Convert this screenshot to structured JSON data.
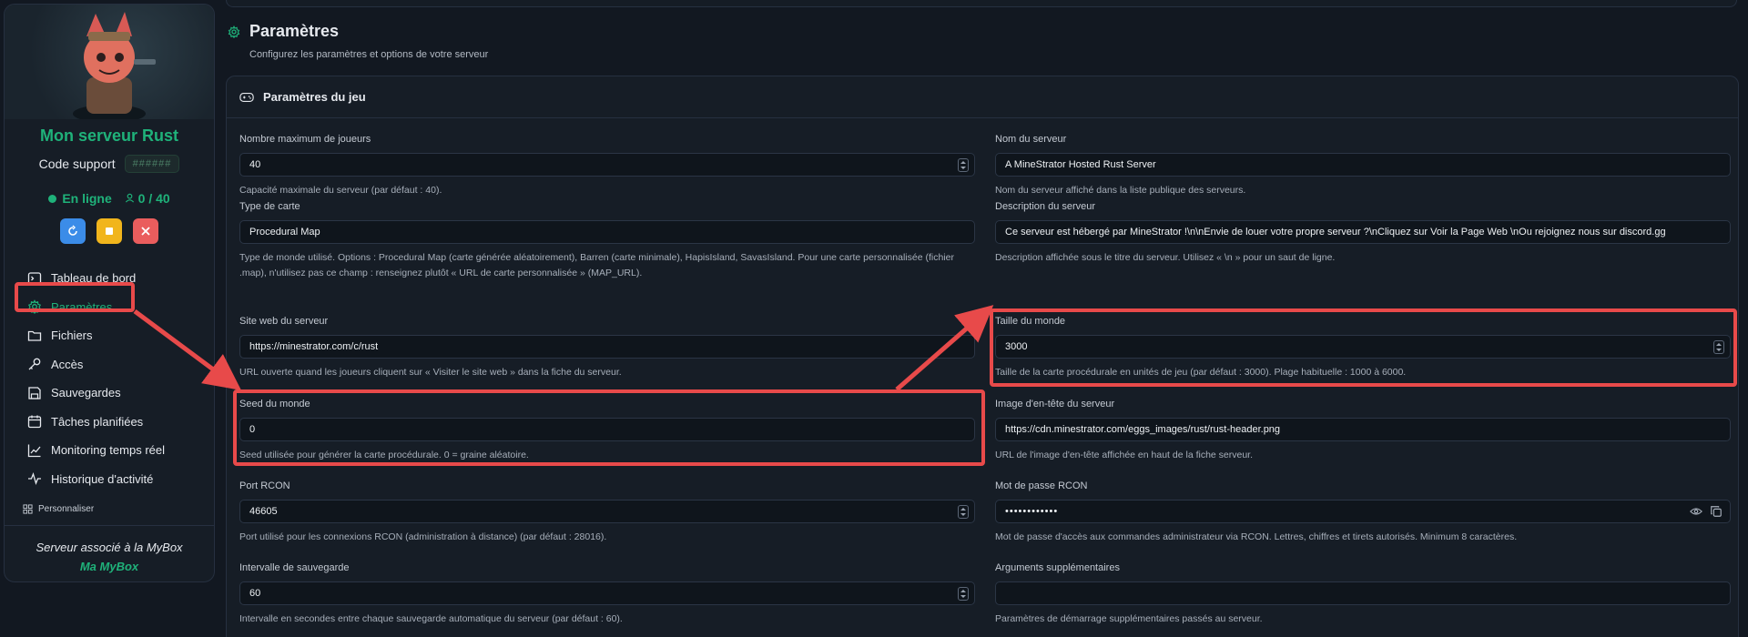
{
  "sidebar": {
    "server_name": "Mon serveur Rust",
    "support_label": "Code support",
    "support_code": "######",
    "status_label": "En ligne",
    "players": "0 / 40",
    "items": [
      {
        "label": "Tableau de bord",
        "icon": "terminal-icon"
      },
      {
        "label": "Paramètres",
        "icon": "gear-icon",
        "active": true
      },
      {
        "label": "Fichiers",
        "icon": "folder-icon"
      },
      {
        "label": "Accès",
        "icon": "key-icon"
      },
      {
        "label": "Sauvegardes",
        "icon": "save-icon"
      },
      {
        "label": "Tâches planifiées",
        "icon": "calendar-icon"
      },
      {
        "label": "Monitoring temps réel",
        "icon": "chart-line-icon"
      },
      {
        "label": "Historique d'activité",
        "icon": "activity-icon"
      }
    ],
    "personnaliser": "Personnaliser",
    "mybox_text": "Serveur associé à la MyBox",
    "mybox_link": "Ma MyBox"
  },
  "page": {
    "title": "Paramètres",
    "subtitle": "Configurez les paramètres et options de votre serveur"
  },
  "card": {
    "title": "Paramètres du jeu"
  },
  "fields": {
    "max_players": {
      "label": "Nombre maximum de joueurs",
      "value": "40",
      "hint": "Capacité maximale du serveur (par défaut : 40)."
    },
    "server_name": {
      "label": "Nom du serveur",
      "value": "A MineStrator Hosted Rust Server",
      "hint": "Nom du serveur affiché dans la liste publique des serveurs."
    },
    "map_type": {
      "label": "Type de carte",
      "value": "Procedural Map",
      "hint": "Type de monde utilisé. Options : Procedural Map (carte générée aléatoirement), Barren (carte minimale), HapisIsland, SavasIsland. Pour une carte personnalisée (fichier .map), n'utilisez pas ce champ : renseignez plutôt « URL de carte personnalisée » (MAP_URL)."
    },
    "description": {
      "label": "Description du serveur",
      "value": "Ce serveur est hébergé par MineStrator !\\n\\nEnvie de louer votre propre serveur ?\\nCliquez sur Voir la Page Web \\nOu rejoignez nous sur discord.gg",
      "hint": "Description affichée sous le titre du serveur. Utilisez « \\n » pour un saut de ligne."
    },
    "website": {
      "label": "Site web du serveur",
      "value": "https://minestrator.com/c/rust",
      "hint": "URL ouverte quand les joueurs cliquent sur « Visiter le site web » dans la fiche du serveur."
    },
    "world_size": {
      "label": "Taille du monde",
      "value": "3000",
      "hint": "Taille de la carte procédurale en unités de jeu (par défaut : 3000). Plage habituelle : 1000 à 6000."
    },
    "seed": {
      "label": "Seed du monde",
      "value": "0",
      "hint": "Seed utilisée pour générer la carte procédurale. 0 = graine aléatoire."
    },
    "header_image": {
      "label": "Image d'en-tête du serveur",
      "value": "https://cdn.minestrator.com/eggs_images/rust/rust-header.png",
      "hint": "URL de l'image d'en-tête affichée en haut de la fiche serveur."
    },
    "rcon_port": {
      "label": "Port RCON",
      "value": "46605",
      "hint": "Port utilisé pour les connexions RCON (administration à distance) (par défaut : 28016)."
    },
    "rcon_password": {
      "label": "Mot de passe RCON",
      "value": "••••••••••••",
      "hint": "Mot de passe d'accès aux commandes administrateur via RCON. Lettres, chiffres et tirets autorisés. Minimum 8 caractères."
    },
    "save_interval": {
      "label": "Intervalle de sauvegarde",
      "value": "60",
      "hint": "Intervalle en secondes entre chaque sauvegarde automatique du serveur (par défaut : 60)."
    },
    "extra_args": {
      "label": "Arguments supplémentaires",
      "value": "",
      "hint": "Paramètres de démarrage supplémentaires passés au serveur."
    }
  },
  "colors": {
    "accent": "#1fb27a",
    "highlight": "#e84a4a",
    "background": "#121821"
  }
}
